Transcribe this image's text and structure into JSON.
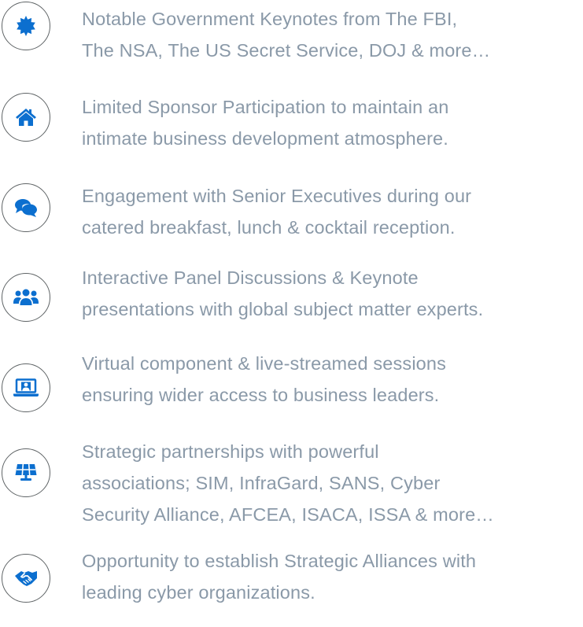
{
  "accent_color": "#0c6fcf",
  "text_color": "#8a99a8",
  "features": [
    {
      "icon": "badge-seal-icon",
      "text": "Notable Government Keynotes from The FBI,\nThe NSA, The US Secret Service, DOJ & more…"
    },
    {
      "icon": "home-icon",
      "text": "Limited Sponsor Participation to maintain an\nintimate business development atmosphere."
    },
    {
      "icon": "comments-icon",
      "text": "Engagement with Senior Executives during our\ncatered breakfast, lunch & cocktail reception."
    },
    {
      "icon": "users-icon",
      "text": "Interactive Panel Discussions & Keynote\npresentations with global subject matter experts."
    },
    {
      "icon": "laptop-user-icon",
      "text": "Virtual component & live-streamed sessions\nensuring wider access to business leaders."
    },
    {
      "icon": "solar-panel-icon",
      "text": "Strategic partnerships with powerful\nassociations; SIM, InfraGard, SANS, Cyber\nSecurity Alliance, AFCEA, ISACA, ISSA & more…"
    },
    {
      "icon": "handshake-icon",
      "text": "Opportunity to establish Strategic Alliances with\nleading cyber organizations."
    }
  ]
}
